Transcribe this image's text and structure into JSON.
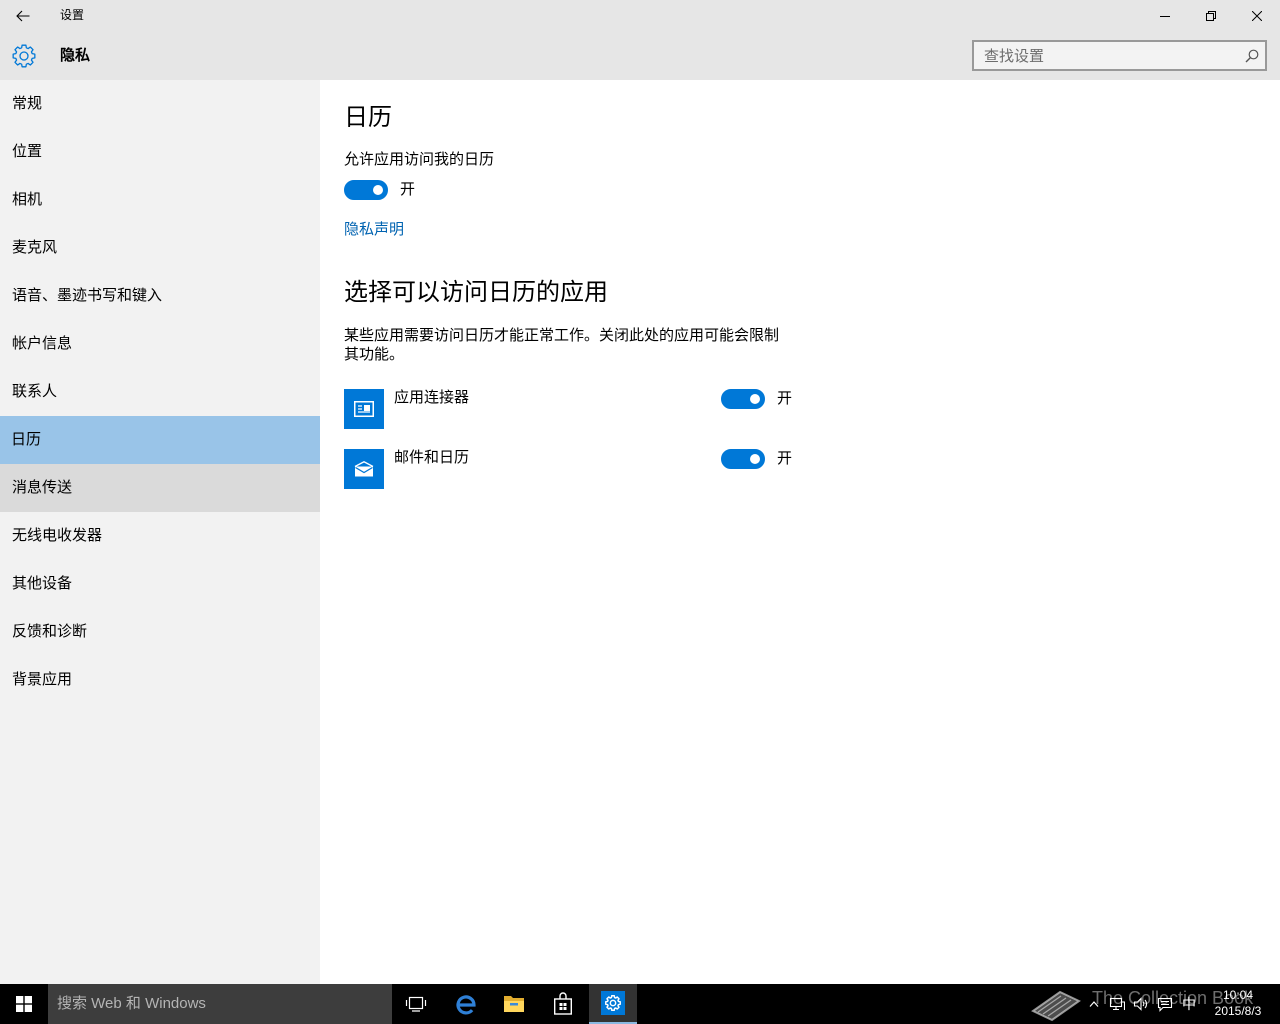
{
  "window": {
    "title": "设置",
    "back_icon": "back-arrow-icon",
    "minimize_icon": "minimize-icon",
    "restore_icon": "restore-icon",
    "close_icon": "close-icon"
  },
  "header": {
    "icon": "gear-icon",
    "title": "隐私",
    "search": {
      "placeholder": "查找设置",
      "value": "",
      "icon": "search-icon"
    }
  },
  "sidebar": {
    "items": [
      {
        "label": "常规"
      },
      {
        "label": "位置"
      },
      {
        "label": "相机"
      },
      {
        "label": "麦克风"
      },
      {
        "label": "语音、墨迹书写和键入"
      },
      {
        "label": "帐户信息"
      },
      {
        "label": "联系人"
      },
      {
        "label": "日历",
        "selected": true
      },
      {
        "label": "消息传送",
        "hovered": true
      },
      {
        "label": "无线电收发器"
      },
      {
        "label": "其他设备"
      },
      {
        "label": "反馈和诊断"
      },
      {
        "label": "背景应用"
      }
    ]
  },
  "main": {
    "title": "日历",
    "access_setting": {
      "label": "允许应用访问我的日历",
      "on": true,
      "state_label": "开"
    },
    "privacy_link": "隐私声明",
    "apps_section": {
      "heading": "选择可以访问日历的应用",
      "description": "某些应用需要访问日历才能正常工作。关闭此处的应用可能会限制其功能。",
      "apps": [
        {
          "name": "应用连接器",
          "icon": "app-connector-icon",
          "on": true,
          "state_label": "开"
        },
        {
          "name": "邮件和日历",
          "icon": "mail-calendar-icon",
          "on": true,
          "state_label": "开"
        }
      ]
    }
  },
  "taskbar": {
    "start_icon": "windows-logo-icon",
    "search": {
      "placeholder": "搜索 Web 和 Windows"
    },
    "pinned_icons": [
      "task-view-icon",
      "edge-icon",
      "file-explorer-icon",
      "store-icon",
      "settings-icon"
    ],
    "active_icon": "settings-icon",
    "tray": {
      "icons": [
        "show-hidden-icons-icon",
        "network-icon",
        "volume-icon",
        "action-center-icon"
      ],
      "ime": "中",
      "time": "10:04",
      "date": "2015/8/3"
    }
  },
  "watermark": {
    "text": "The Collection Book",
    "icon": "book-icon"
  },
  "colors": {
    "accent": "#0078d7",
    "title_bar_bg": "#e6e6e6",
    "sidebar_bg": "#f2f2f2",
    "selected_item_bg": "#99c4e8",
    "hovered_item_bg": "#dadada",
    "link": "#0063b1",
    "taskbar_bg": "#000000",
    "taskbar_search_bg": "#3d3d3d"
  }
}
